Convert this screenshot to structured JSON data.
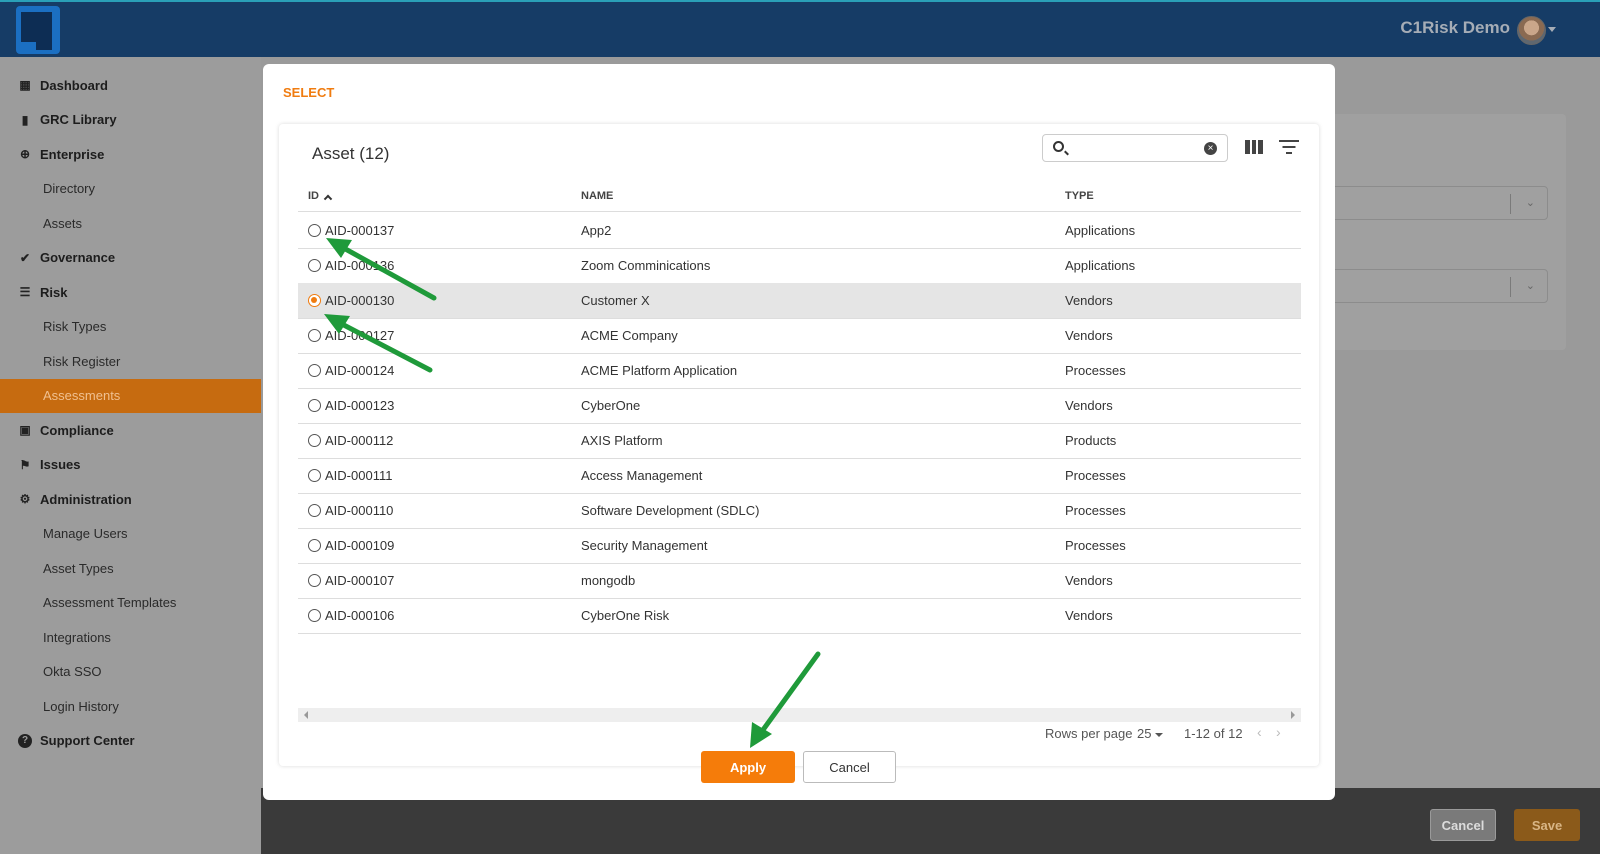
{
  "topbar": {
    "brand": "C1Risk Demo",
    "logo_icon": "c1-logo-icon",
    "avatar_icon": "user-avatar-icon"
  },
  "sidebar": {
    "items": [
      {
        "label": "Dashboard",
        "level": "top",
        "icon": "dashboard-grid-icon"
      },
      {
        "label": "GRC Library",
        "level": "top",
        "icon": "book-icon"
      },
      {
        "label": "Enterprise",
        "level": "top",
        "icon": "globe-icon"
      },
      {
        "label": "Directory",
        "level": "sub"
      },
      {
        "label": "Assets",
        "level": "sub"
      },
      {
        "label": "Governance",
        "level": "top",
        "icon": "check-icon"
      },
      {
        "label": "Risk",
        "level": "top",
        "icon": "list-icon"
      },
      {
        "label": "Risk Types",
        "level": "sub"
      },
      {
        "label": "Risk Register",
        "level": "sub"
      },
      {
        "label": "Assessments",
        "level": "sub",
        "active": true
      },
      {
        "label": "Compliance",
        "level": "top",
        "icon": "clipboard-icon"
      },
      {
        "label": "Issues",
        "level": "top",
        "icon": "flag-icon"
      },
      {
        "label": "Administration",
        "level": "top",
        "icon": "gear-icon"
      },
      {
        "label": "Manage Users",
        "level": "sub"
      },
      {
        "label": "Asset Types",
        "level": "sub"
      },
      {
        "label": "Assessment Templates",
        "level": "sub"
      },
      {
        "label": "Integrations",
        "level": "sub"
      },
      {
        "label": "Okta SSO",
        "level": "sub"
      },
      {
        "label": "Login History",
        "level": "sub"
      },
      {
        "label": "Support Center",
        "level": "top",
        "icon": "question-icon"
      }
    ]
  },
  "modal": {
    "title": "SELECT",
    "card_title": "Asset (12)",
    "search": {
      "value": "",
      "placeholder": ""
    },
    "columns": {
      "id": "ID",
      "name": "NAME",
      "type": "TYPE"
    },
    "rows": [
      {
        "id": "AID-000137",
        "name": "App2",
        "type": "Applications",
        "selected": false
      },
      {
        "id": "AID-000136",
        "name": "Zoom Comminications",
        "type": "Applications",
        "selected": false
      },
      {
        "id": "AID-000130",
        "name": "Customer X",
        "type": "Vendors",
        "selected": true
      },
      {
        "id": "AID-000127",
        "name": "ACME Company",
        "type": "Vendors",
        "selected": false
      },
      {
        "id": "AID-000124",
        "name": "ACME Platform Application",
        "type": "Processes",
        "selected": false
      },
      {
        "id": "AID-000123",
        "name": "CyberOne",
        "type": "Vendors",
        "selected": false
      },
      {
        "id": "AID-000112",
        "name": "AXIS Platform",
        "type": "Products",
        "selected": false
      },
      {
        "id": "AID-000111",
        "name": "Access Management",
        "type": "Processes",
        "selected": false
      },
      {
        "id": "AID-000110",
        "name": "Software Development (SDLC)",
        "type": "Processes",
        "selected": false
      },
      {
        "id": "AID-000109",
        "name": "Security Management",
        "type": "Processes",
        "selected": false
      },
      {
        "id": "AID-000107",
        "name": "mongodb",
        "type": "Vendors",
        "selected": false
      },
      {
        "id": "AID-000106",
        "name": "CyberOne Risk",
        "type": "Vendors",
        "selected": false
      }
    ],
    "pagination": {
      "rows_per_page_label": "Rows per page",
      "rows_per_page_value": "25",
      "range": "1-12 of 12"
    },
    "apply_label": "Apply",
    "cancel_label": "Cancel"
  },
  "footer": {
    "cancel_label": "Cancel",
    "save_label": "Save"
  },
  "colors": {
    "accent": "#f57c0a",
    "topbar": "#163c66",
    "annotation_arrow": "#1f9a3a"
  }
}
